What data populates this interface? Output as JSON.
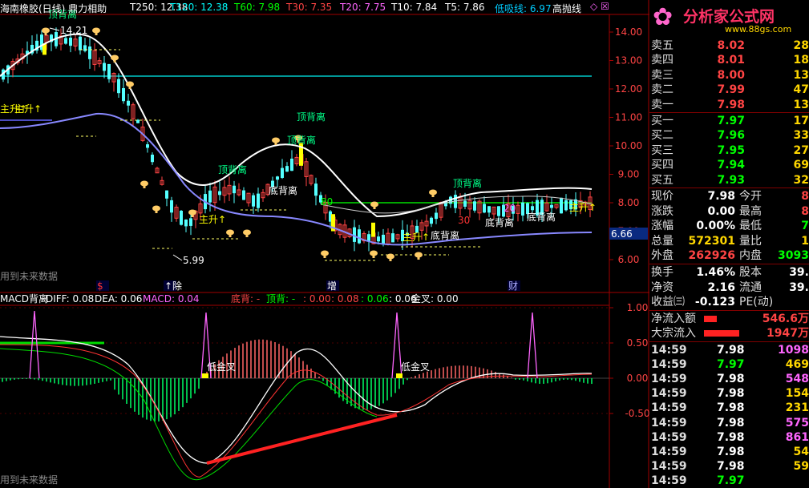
{
  "header": {
    "title": "海南橡胶(日线) 鼎力相助",
    "ma": [
      {
        "label": "T250: 12.38",
        "color": "#ffffff"
      },
      {
        "label": "T120: 12.38",
        "color": "#00ffff"
      },
      {
        "label": "T60: 7.98",
        "color": "#00ff00"
      },
      {
        "label": "T30: 7.35",
        "color": "#ff4444"
      },
      {
        "label": "T20: 7.75",
        "color": "#ff66ff"
      },
      {
        "label": "T10: 7.84",
        "color": "#ffffff"
      },
      {
        "label": "T5: 7.86",
        "color": "#ffffff"
      },
      {
        "label": "低吸线: 6.97",
        "color": "#00ccff"
      },
      {
        "label": "高抛线",
        "color": "#ffffff"
      }
    ]
  },
  "logo": {
    "text": "分析家公式网",
    "url": "www.88gs.com"
  },
  "main_chart": {
    "price_axis": [
      "14.00",
      "13.00",
      "12.00",
      "11.00",
      "10.00",
      "9.00",
      "8.00",
      "7.00",
      "6.00"
    ],
    "current_price_tag": "6.66",
    "high_label": "14.21",
    "low_label": "5.99",
    "future_note": "用到未来数据",
    "annotations": [
      {
        "text": "顶背离",
        "color": "#00ff88"
      },
      {
        "text": "顶背离",
        "color": "#00ff88"
      },
      {
        "text": "顶背离",
        "color": "#00ff88"
      },
      {
        "text": "顶背离",
        "color": "#00ff88"
      },
      {
        "text": "顶背离",
        "color": "#00ff88"
      },
      {
        "text": "底背离",
        "color": "#ffffff"
      },
      {
        "text": "底背离",
        "color": "#ffffff"
      },
      {
        "text": "底背离",
        "color": "#ffffff"
      },
      {
        "text": "底背离",
        "color": "#ffffff"
      },
      {
        "text": "主升↑",
        "color": "#ffff00"
      },
      {
        "text": "主升↑",
        "color": "#ffff00"
      },
      {
        "text": "主升↑",
        "color": "#ffff00"
      },
      {
        "text": "主升↑",
        "color": "#ffff00"
      },
      {
        "text": "主升↑",
        "color": "#ffff00"
      },
      {
        "text": "80",
        "color": "#00ff00"
      },
      {
        "text": "30",
        "color": "#ff3333"
      },
      {
        "text": "20",
        "color": "#ff66ff"
      }
    ],
    "events": [
      {
        "text": "$",
        "color": "#ff3333"
      },
      {
        "text": "↑除",
        "color": "#ffffff"
      },
      {
        "text": "增",
        "color": "#ffffff"
      },
      {
        "text": "财",
        "color": "#aaaaff"
      }
    ]
  },
  "macd": {
    "title": "MACD背离",
    "diff": "DIFF: 0.08",
    "dea": "DEA: 0.06",
    "macd": "MACD: 0.04",
    "extra": [
      {
        "text": "底背: -",
        "color": "#ff4444"
      },
      {
        "text": "顶背: -",
        "color": "#00ff00"
      },
      {
        "text": ": 0.00",
        "color": "#ff4444"
      },
      {
        "text": ": 0.08",
        "color": "#ff4444"
      },
      {
        "text": ": 0.06",
        "color": "#00ff00"
      },
      {
        "text": ": 0.06",
        "color": "#ffffff"
      },
      {
        "text": "金叉: 0.00",
        "color": "#ffffff"
      }
    ],
    "axis": [
      "1.00",
      "0.50",
      "0.00",
      "-0.50"
    ],
    "labels": [
      "低金叉",
      "低金叉"
    ],
    "future_note": "用到未来数据"
  },
  "quote": {
    "asks": [
      {
        "label": "卖五",
        "price": "8.02",
        "vol": "28"
      },
      {
        "label": "卖四",
        "price": "8.01",
        "vol": "18"
      },
      {
        "label": "卖三",
        "price": "8.00",
        "vol": "13"
      },
      {
        "label": "卖二",
        "price": "7.99",
        "vol": "47"
      },
      {
        "label": "卖一",
        "price": "7.98",
        "vol": "13"
      }
    ],
    "bids": [
      {
        "label": "买一",
        "price": "7.97",
        "vol": "17"
      },
      {
        "label": "买二",
        "price": "7.96",
        "vol": "33"
      },
      {
        "label": "买三",
        "price": "7.95",
        "vol": "27"
      },
      {
        "label": "买四",
        "price": "7.94",
        "vol": "69"
      },
      {
        "label": "买五",
        "price": "7.93",
        "vol": "32"
      }
    ],
    "stats": [
      {
        "l1": "现价",
        "v1": "7.98",
        "c1": "#ffffff",
        "l2": "今开",
        "v2": "8",
        "c2": "#ff4444"
      },
      {
        "l1": "涨跌",
        "v1": "0.00",
        "c1": "#ffffff",
        "l2": "最高",
        "v2": "8",
        "c2": "#ff4444"
      },
      {
        "l1": "涨幅",
        "v1": "0.00%",
        "c1": "#ffffff",
        "l2": "最低",
        "v2": "7",
        "c2": "#00ff00"
      },
      {
        "l1": "总量",
        "v1": "572301",
        "c1": "#ffd700",
        "l2": "量比",
        "v2": "1",
        "c2": "#ffd700"
      },
      {
        "l1": "外盘",
        "v1": "262926",
        "c1": "#ff4444",
        "l2": "内盘",
        "v2": "3093",
        "c2": "#00ff00"
      }
    ],
    "fin": [
      {
        "l1": "换手",
        "v1": "1.46%",
        "l2": "股本",
        "v2": "39."
      },
      {
        "l1": "净资",
        "v1": "2.16",
        "l2": "流通",
        "v2": "39."
      },
      {
        "l1": "收益㈢",
        "v1": "-0.123",
        "l2": "PE(动)",
        "v2": ""
      }
    ],
    "flow": [
      {
        "label": "净流入额",
        "value": "546.6万"
      },
      {
        "label": "大宗流入",
        "value": "1947万"
      }
    ],
    "ticks": [
      {
        "t": "14:59",
        "p": "7.98",
        "pc": "#ffffff",
        "v": "1098",
        "vc": "#ff66ff"
      },
      {
        "t": "14:59",
        "p": "7.97",
        "pc": "#00ff00",
        "v": "469",
        "vc": "#ffd700"
      },
      {
        "t": "14:59",
        "p": "7.98",
        "pc": "#ffffff",
        "v": "548",
        "vc": "#ff66ff"
      },
      {
        "t": "14:59",
        "p": "7.98",
        "pc": "#ffffff",
        "v": "154",
        "vc": "#ffd700"
      },
      {
        "t": "14:59",
        "p": "7.98",
        "pc": "#ffffff",
        "v": "231",
        "vc": "#ffd700"
      },
      {
        "t": "14:59",
        "p": "7.98",
        "pc": "#ffffff",
        "v": "575",
        "vc": "#ff66ff"
      },
      {
        "t": "14:59",
        "p": "7.98",
        "pc": "#ffffff",
        "v": "861",
        "vc": "#ff66ff"
      },
      {
        "t": "14:59",
        "p": "7.98",
        "pc": "#ffffff",
        "v": "54",
        "vc": "#ffd700"
      },
      {
        "t": "14:59",
        "p": "7.98",
        "pc": "#ffffff",
        "v": "59",
        "vc": "#ffd700"
      },
      {
        "t": "14:59",
        "p": "7.97",
        "pc": "#00ff00",
        "v": "",
        "vc": "#ffd700"
      }
    ]
  }
}
